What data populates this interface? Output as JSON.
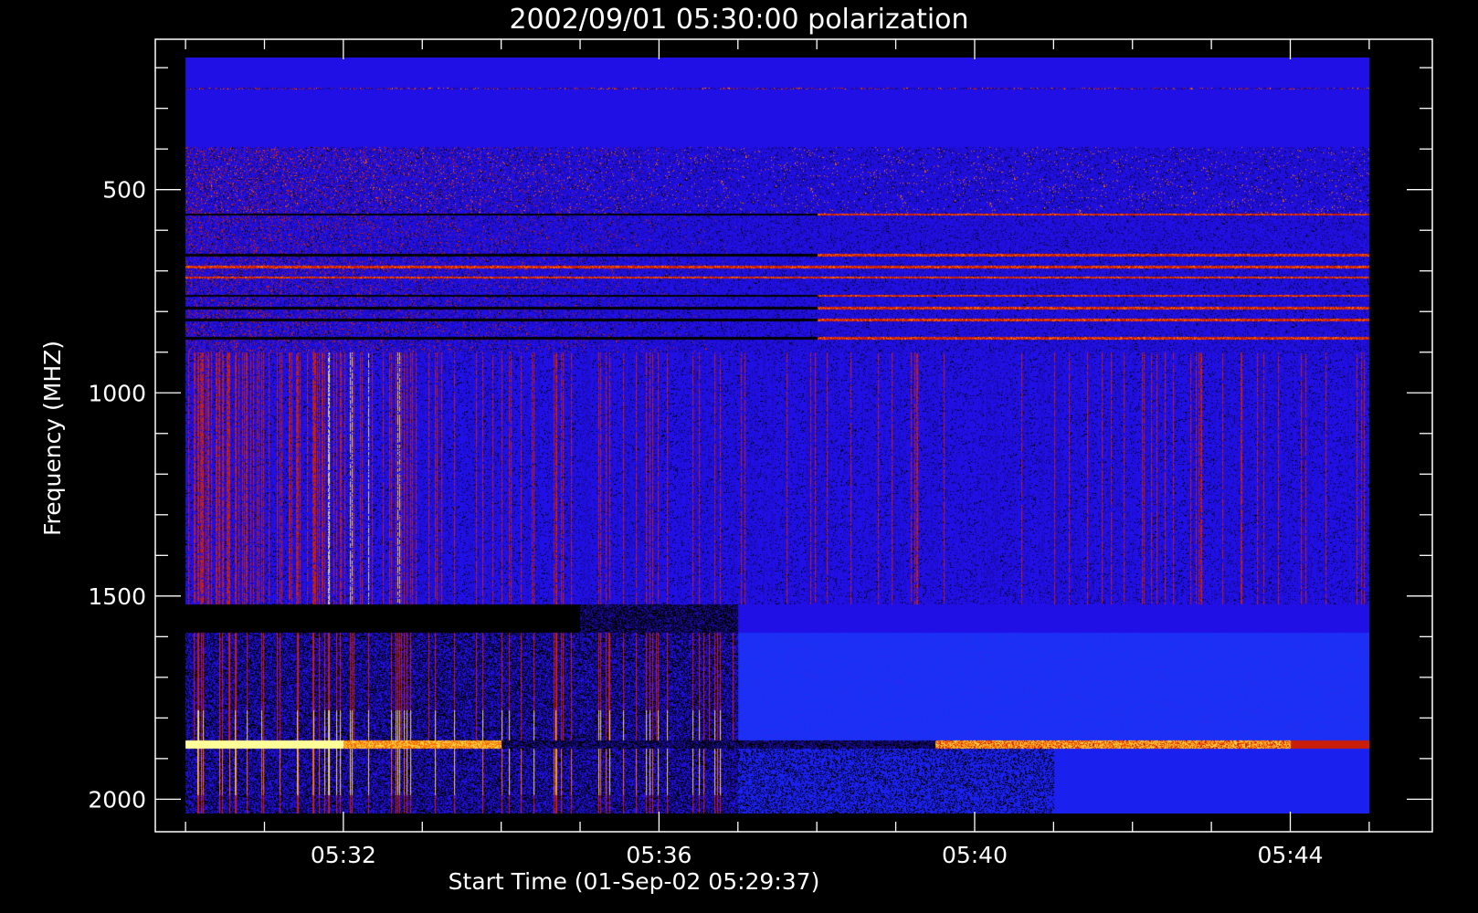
{
  "chart_data": {
    "type": "heatmap",
    "title": "2002/09/01 05:30:00 polarization",
    "xlabel": "Start Time (01-Sep-02 05:29:37)",
    "ylabel": "Frequency (MHZ)",
    "x_range": [
      "05:29:37",
      "05:45:48"
    ],
    "data_x_range": [
      "05:30:00",
      "05:45:00"
    ],
    "y_range_mhz": [
      130,
      2080
    ],
    "data_y_range_mhz": [
      175,
      2035
    ],
    "y_ticks": [
      500,
      1000,
      1500,
      2000
    ],
    "y_ticks_display": [
      "500",
      "1000",
      "1500",
      "2000"
    ],
    "y_minor_step_mhz": 100,
    "x_ticks": [
      "05:32",
      "05:36",
      "05:40",
      "05:44"
    ],
    "x_minor_step_min": 1,
    "grid": false,
    "colormap": [
      "#000000",
      "#1a0aa0",
      "#2010e6",
      "#c81e0a",
      "#ff6a00",
      "#ffd040",
      "#ffff9a"
    ],
    "background_value_color": "#2010e6",
    "band_features": [
      {
        "from_mhz": 175,
        "to_mhz": 395,
        "state": "quiet uniform"
      },
      {
        "at_mhz": 250,
        "state": "thin red dashed line across full time range"
      },
      {
        "from_mhz": 395,
        "to_mhz": 900,
        "state": "noisy with red/yellow horizontal streaks"
      },
      {
        "from_mhz": 900,
        "to_mhz": 1520,
        "state": "vertical red/yellow striations, strongest before 05:37"
      },
      {
        "from_mhz": 1520,
        "to_mhz": 1590,
        "state": "black gap until ~05:36, then blue"
      },
      {
        "from_mhz": 1590,
        "to_mhz": 1855,
        "state": "vertical striations early, bright blue later"
      },
      {
        "at_mhz": 1865,
        "state": "bright yellow-red horizontal line (strong from 05:30–05:33 and 05:40–05:44)"
      },
      {
        "from_mhz": 1875,
        "to_mhz": 2035,
        "state": "striations with red bursts near bottom before 05:37"
      }
    ]
  }
}
